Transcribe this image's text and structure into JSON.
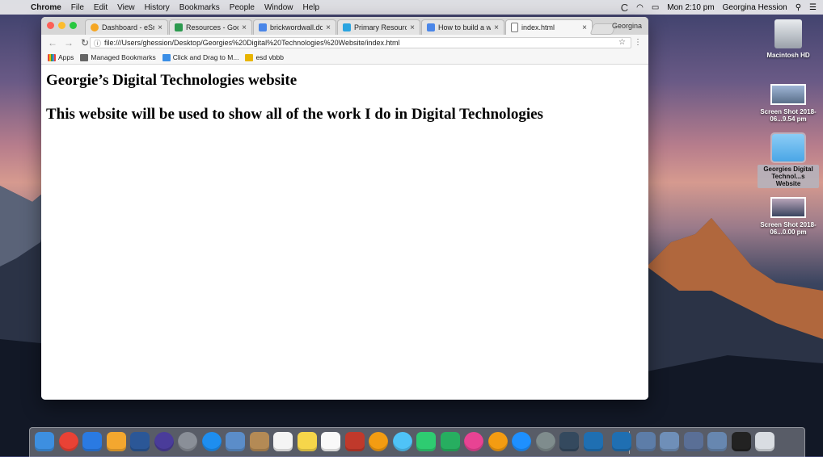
{
  "menubar": {
    "app": "Chrome",
    "items": [
      "File",
      "Edit",
      "View",
      "History",
      "Bookmarks",
      "People",
      "Window",
      "Help"
    ],
    "clock": "Mon 2:10 pm",
    "user": "Georgina Hession"
  },
  "browser": {
    "tabs": [
      {
        "label": "Dashboard - eSmar",
        "color": "#f5a623"
      },
      {
        "label": "Resources - Google",
        "color": "#2c9a4f"
      },
      {
        "label": "brickwordwall.doc",
        "color": "#4a86e8"
      },
      {
        "label": "Primary Resources",
        "color": "#2aa4e0"
      },
      {
        "label": "How to build a webs",
        "color": "#4a86e8"
      },
      {
        "label": "index.html",
        "color": "#ffffff"
      }
    ],
    "profile": "Georgina",
    "url": "file:///Users/ghession/Desktop/Georgies%20Digital%20Technologies%20Website/index.html",
    "bookmarks": [
      {
        "label": "Apps",
        "color": "#e4483b"
      },
      {
        "label": "Managed Bookmarks",
        "color": "#666666"
      },
      {
        "label": "Click and Drag to M...",
        "color": "#3a8ee6"
      },
      {
        "label": "esd vbbb",
        "color": "#e8b400"
      }
    ]
  },
  "page": {
    "heading1": "Georgie’s Digital Technologies website",
    "heading2": "This website will be used to show all of the work I do in Digital Technologies"
  },
  "desktop": [
    {
      "label": "Macintosh HD",
      "icon": "hard-drive-icon"
    },
    {
      "label": "Screen Shot 2018-06...9.54 pm",
      "icon": "screenshot-icon"
    },
    {
      "label": "Georgies Digital Technol...s Website",
      "icon": "folder-icon"
    },
    {
      "label": "Screen Shot 2018-06...0.00 pm",
      "icon": "screenshot-icon"
    }
  ],
  "dock": [
    {
      "name": "finder-icon",
      "color": "#3d8fe0"
    },
    {
      "name": "chrome-icon",
      "color": "#e94235"
    },
    {
      "name": "keynote-icon",
      "color": "#2a7ae2"
    },
    {
      "name": "pages-icon",
      "color": "#f3a72f"
    },
    {
      "name": "word-icon",
      "color": "#2b5797"
    },
    {
      "name": "siri-icon",
      "color": "#4a3c9a"
    },
    {
      "name": "launchpad-icon",
      "color": "#8a8f98"
    },
    {
      "name": "safari-icon",
      "color": "#1e8ef0"
    },
    {
      "name": "preview-icon",
      "color": "#5b8dc9"
    },
    {
      "name": "contacts-icon",
      "color": "#b48a55"
    },
    {
      "name": "calendar-icon",
      "color": "#f4f4f4"
    },
    {
      "name": "notes-icon",
      "color": "#f6d64a"
    },
    {
      "name": "reminders-icon",
      "color": "#f9f9f9"
    },
    {
      "name": "photo-booth-icon",
      "color": "#c0392b"
    },
    {
      "name": "photos-icon",
      "color": "#f39c12"
    },
    {
      "name": "messages-icon",
      "color": "#4fc3f7"
    },
    {
      "name": "facetime-icon",
      "color": "#2ecc71"
    },
    {
      "name": "numbers-icon",
      "color": "#27ae60"
    },
    {
      "name": "itunes-icon",
      "color": "#e84393"
    },
    {
      "name": "ibooks-icon",
      "color": "#f39c12"
    },
    {
      "name": "app-store-icon",
      "color": "#1e90ff"
    },
    {
      "name": "system-preferences-icon",
      "color": "#7f8c8d"
    },
    {
      "name": "terminal-icon",
      "color": "#34495e"
    },
    {
      "name": "vscode-icon",
      "color": "#1f6fb2"
    },
    {
      "name": "vscode-icon",
      "color": "#1f6fb2"
    },
    {
      "name": "window-thumbnail-icon",
      "color": "#5d7da8"
    },
    {
      "name": "window-thumbnail-icon",
      "color": "#6f8fb8"
    },
    {
      "name": "window-thumbnail-icon",
      "color": "#5a6f96"
    },
    {
      "name": "window-thumbnail-icon",
      "color": "#6787b0"
    },
    {
      "name": "window-thumbnail-icon",
      "color": "#222222"
    },
    {
      "name": "trash-icon",
      "color": "#d9dde2"
    }
  ]
}
